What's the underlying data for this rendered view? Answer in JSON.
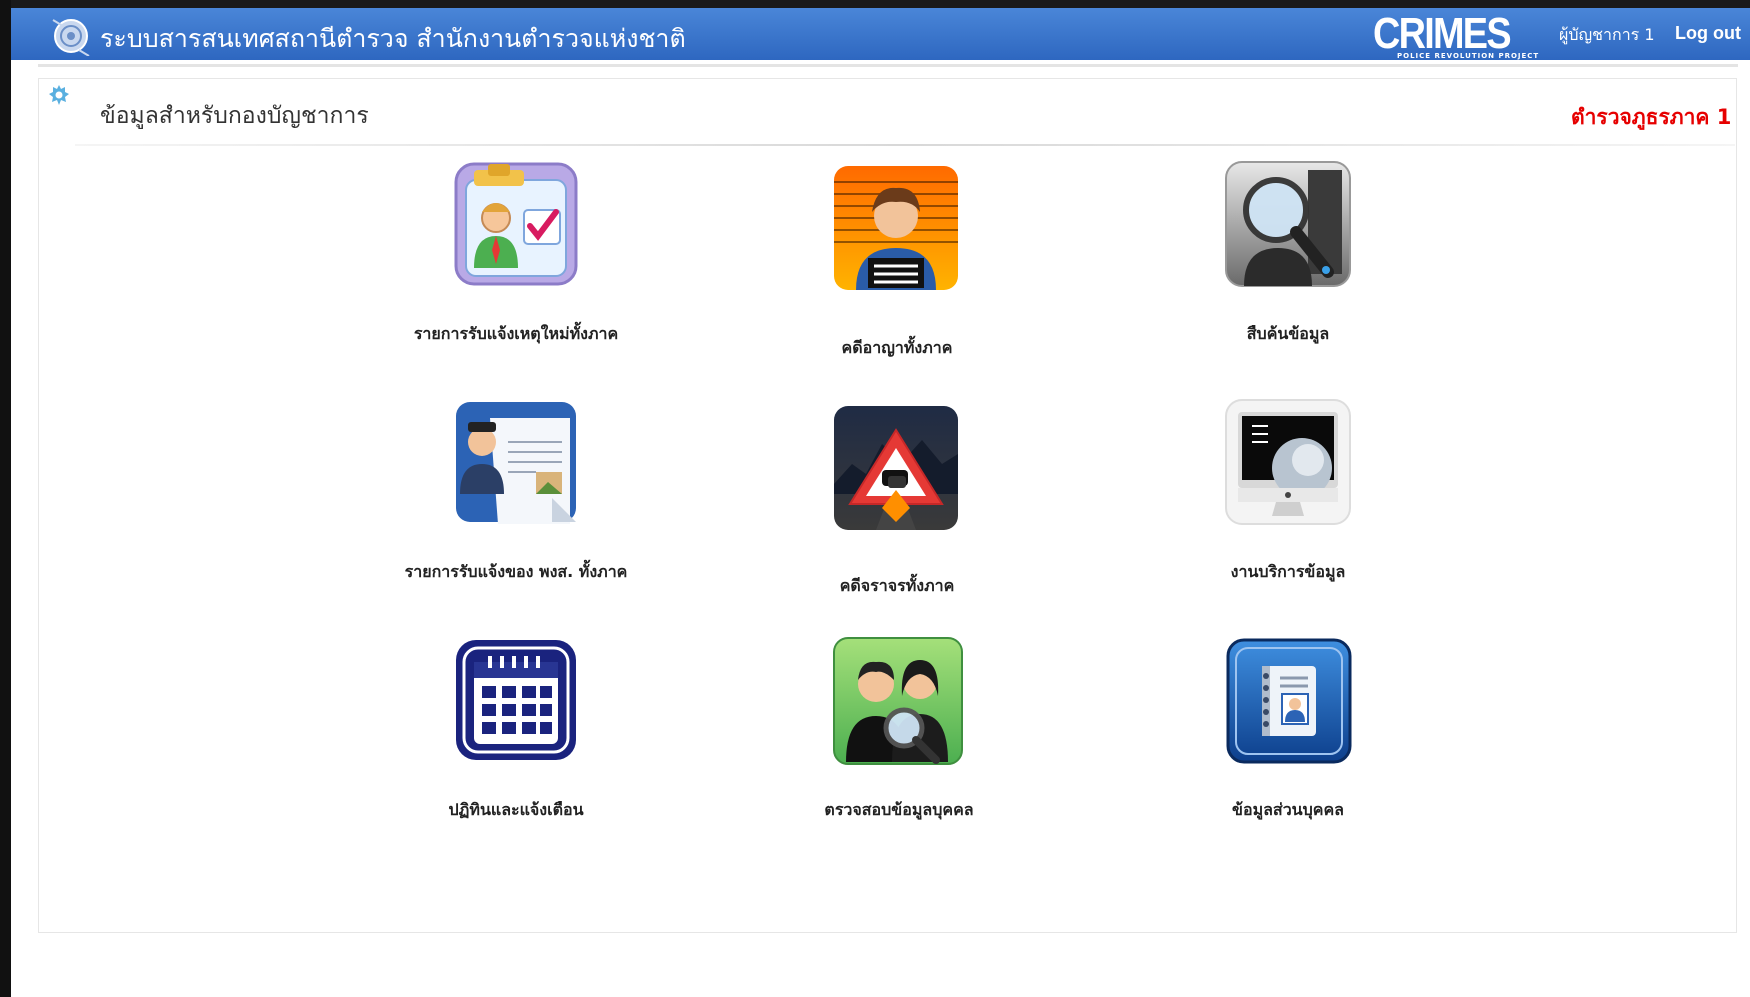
{
  "header": {
    "title": "ระบบสารสนเทศสถานีตำรวจ  สำนักงานตำรวจแห่งชาติ",
    "logo_text": "CRIMES",
    "logo_subtext": "POLICE REVOLUTION PROJECT",
    "user_label": "ผู้บัญชาการ 1",
    "logout_label": "Log out"
  },
  "panel": {
    "title": "ข้อมูลสำหรับกองบัญชาการ",
    "region": "ตำรวจภูธรภาค 1"
  },
  "tiles": [
    {
      "label": "รายการรับแจ้งเหตุใหม่ทั้งภาค",
      "icon": "report-checklist-icon"
    },
    {
      "label": "คดีอาญาทั้งภาค",
      "icon": "suspect-mugshot-icon"
    },
    {
      "label": "สืบค้นข้อมูล",
      "icon": "magnifier-search-icon"
    },
    {
      "label": "รายการรับแจ้งของ พงส. ทั้งภาค",
      "icon": "officer-document-icon"
    },
    {
      "label": "คดีจราจรทั้งภาค",
      "icon": "traffic-warning-icon"
    },
    {
      "label": "งานบริการข้อมูล",
      "icon": "computer-monitor-icon"
    },
    {
      "label": "ปฏิทินและแจ้งเตือน",
      "icon": "calendar-icon"
    },
    {
      "label": "ตรวจสอบข้อมูลบุคคล",
      "icon": "person-search-icon"
    },
    {
      "label": "ข้อมูลส่วนบุคคล",
      "icon": "address-book-icon"
    }
  ],
  "colors": {
    "header": "#3a78d0",
    "region_text": "#e60000"
  }
}
